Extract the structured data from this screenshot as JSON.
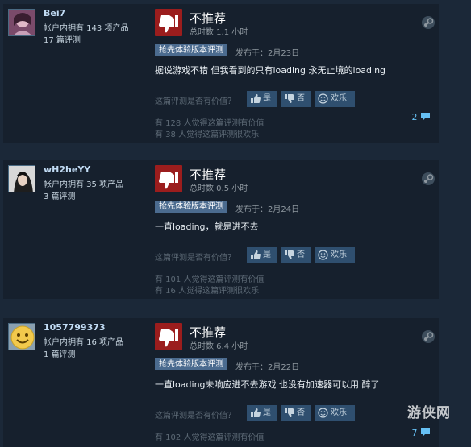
{
  "ui": {
    "helpful_question": "这篇评测是否有价值？",
    "yes_label": "是",
    "no_label": "否",
    "funny_label": "欢乐",
    "early_access_tag": "抢先体验版本评测",
    "verdict": "不推荐",
    "colors": {
      "background": "#1b2838",
      "card": "#16202d",
      "thumb_down": "#9b1d1d",
      "tag": "#4b6b8f",
      "link": "#66c0f4"
    }
  },
  "reviews": [
    {
      "username": "Bei7",
      "products_owned": "帐户内拥有 143 项产品",
      "review_count": "17 篇评测",
      "hours": "总时数 1.1 小时",
      "posted": "发布于：2月23日",
      "text": "据说游戏不错 但我看到的只有loading 永无止境的loading",
      "helpful_stat": "有 128 人觉得这篇评测有价值",
      "funny_stat": "有 38 人觉得这篇评测很欢乐",
      "comments": "2"
    },
    {
      "username": "wH2heYY",
      "products_owned": "帐户内拥有 35 项产品",
      "review_count": "3 篇评测",
      "hours": "总时数 0.5 小时",
      "posted": "发布于：2月24日",
      "text": "一直loading，就是进不去",
      "helpful_stat": "有 101 人觉得这篇评测有价值",
      "funny_stat": "有 16 人觉得这篇评测很欢乐",
      "comments": ""
    },
    {
      "username": "1057799373",
      "products_owned": "帐户内拥有 16 项产品",
      "review_count": "1 篇评测",
      "hours": "总时数 6.4 小时",
      "posted": "发布于：2月22日",
      "text": "一直loading未响应进不去游戏 也没有加速器可以用 醉了",
      "helpful_stat": "有 102 人觉得这篇评测有价值",
      "funny_stat": "",
      "comments": "7"
    }
  ],
  "watermark": "游侠网"
}
